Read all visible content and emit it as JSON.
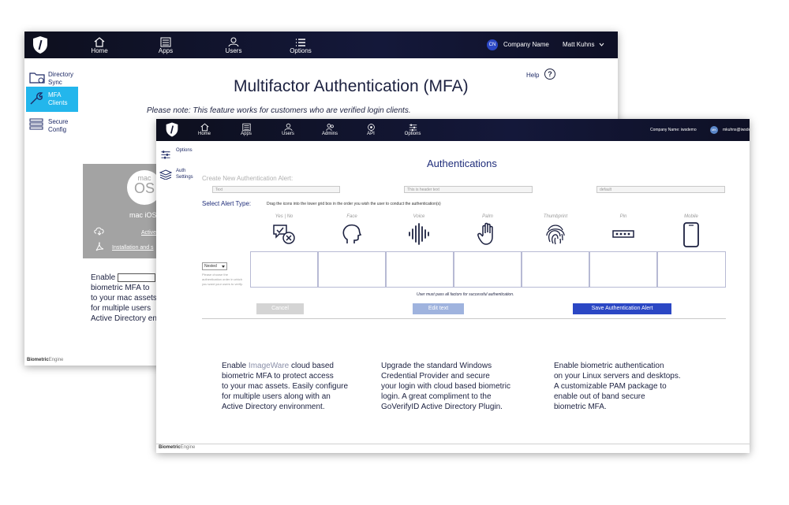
{
  "back_window": {
    "nav": {
      "items": [
        {
          "label": "Home",
          "icon": "home-icon"
        },
        {
          "label": "Apps",
          "icon": "apps-icon"
        },
        {
          "label": "Users",
          "icon": "user-icon"
        },
        {
          "label": "Options",
          "icon": "list-icon"
        }
      ],
      "org_badge": "CN",
      "company": "Company Name",
      "user": "Matt Kuhns"
    },
    "sidebar": [
      {
        "label_1": "Directory",
        "label_2": "Sync"
      },
      {
        "label_1": "MFA",
        "label_2": "Clients"
      },
      {
        "label_1": "Secure",
        "label_2": "Config"
      }
    ],
    "title": "Multifactor Authentication (MFA)",
    "help": "Help",
    "note": "Please note: This feature works for customers who are verified login clients.",
    "card": {
      "logo_small": "mac",
      "logo_big": "OS",
      "name": "mac iOS",
      "link": "Active",
      "install": "Installation and s"
    },
    "desc_lines": [
      "Enable",
      "biometric MFA to",
      "to your mac assets",
      "for multiple users",
      "Active Directory en"
    ],
    "footer_brand_a": "Biometric",
    "footer_brand_b": "Engine"
  },
  "front_window": {
    "nav": {
      "items": [
        {
          "label": "Home",
          "icon": "home-icon"
        },
        {
          "label": "Apps",
          "icon": "apps-icon"
        },
        {
          "label": "Users",
          "icon": "user-icon"
        },
        {
          "label": "Admins",
          "icon": "admins-icon"
        },
        {
          "label": "API",
          "icon": "api-icon"
        },
        {
          "label": "Options",
          "icon": "sliders-icon"
        }
      ],
      "company": "Company Name: iwsdemo",
      "avatar": "MK",
      "user": "mkuhns@iwsdem"
    },
    "sidebar": [
      {
        "label_1": "Options",
        "label_2": ""
      },
      {
        "label_1": "Auth",
        "label_2": "Settings"
      }
    ],
    "title": "Authentications",
    "create_label": "Create New Authentication Alert:",
    "inputs": {
      "text": "Text",
      "header": "This is header text",
      "default": "default"
    },
    "alert_type_label": "Select Alert Type:",
    "instructions": "Drag the icons into the lower grid box in the order you wish the user to conduct the authentication(s)",
    "factors": [
      {
        "label": "Yes | No",
        "icon": "yes-no-icon"
      },
      {
        "label": "Face",
        "icon": "face-icon"
      },
      {
        "label": "Voice",
        "icon": "voice-icon"
      },
      {
        "label": "Palm",
        "icon": "palm-icon"
      },
      {
        "label": "Thumbprint",
        "icon": "thumbprint-icon"
      },
      {
        "label": "Pin",
        "icon": "pin-icon"
      },
      {
        "label": "Mobile",
        "icon": "mobile-icon"
      }
    ],
    "nested_select": "Nested",
    "nested_help": "Please choose the authentication order in which you want your users to verify.",
    "must_pass": "User must pass all factors for successful authentication.",
    "buttons": {
      "cancel": "Cancel",
      "edit": "Edit text",
      "save": "Save Authentication Alert"
    },
    "descriptions": [
      {
        "pre": "Enable",
        "brand": "ImageWare",
        "rest": "cloud based",
        "lines": [
          "biometric MFA to  protect access",
          "to your mac assets.  Easily configure",
          "for multiple users along with an",
          "Active Directory environment."
        ]
      },
      {
        "lines": [
          "Upgrade the standard Windows",
          "Credential Provider and secure",
          "your login with cloud based biometric",
          "login.  A great compliment to the",
          "GoVerifyID Active Directory Plugin."
        ]
      },
      {
        "lines": [
          "Enable biometric authentication",
          "on your Linux servers and desktops.",
          "A customizable PAM package to",
          "enable out of band secure",
          "biometric MFA."
        ]
      }
    ],
    "footer_brand_a": "Biometric",
    "footer_brand_b": "Engine"
  },
  "colors": {
    "nav_bg": "#11142e",
    "accent_blue": "#2b47c4",
    "mfa_active": "#23b6ec",
    "edit_btn": "#9fb3de",
    "cancel_btn": "#d4d4d4"
  }
}
